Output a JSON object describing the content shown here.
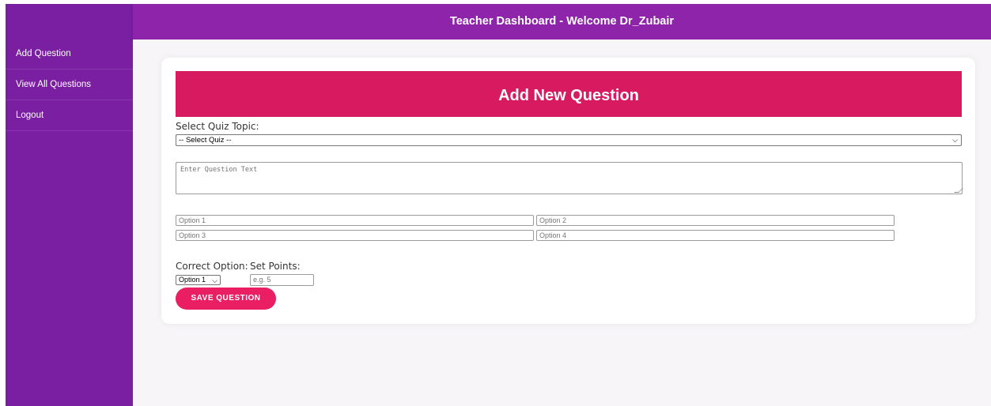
{
  "header": {
    "title": "Teacher Dashboard - Welcome Dr_Zubair"
  },
  "sidebar": {
    "items": [
      {
        "label": "Add Question"
      },
      {
        "label": "View All Questions"
      },
      {
        "label": "Logout"
      }
    ]
  },
  "form": {
    "banner_title": "Add New Question",
    "quiz_topic_label": "Select Quiz Topic:",
    "quiz_select_value": "-- Select Quiz --",
    "question_placeholder": "Enter Question Text",
    "options": [
      {
        "placeholder": "Option 1"
      },
      {
        "placeholder": "Option 2"
      },
      {
        "placeholder": "Option 3"
      },
      {
        "placeholder": "Option 4"
      }
    ],
    "correct_option_label": "Correct Option:",
    "correct_option_value": "Option 1",
    "points_label": "Set Points:",
    "points_placeholder": "e.g. 5",
    "save_label": "SAVE QUESTION"
  },
  "colors": {
    "sidebar": "#7b1fa2",
    "header": "#8e24aa",
    "banner": "#d81b60",
    "button": "#e91e63"
  }
}
